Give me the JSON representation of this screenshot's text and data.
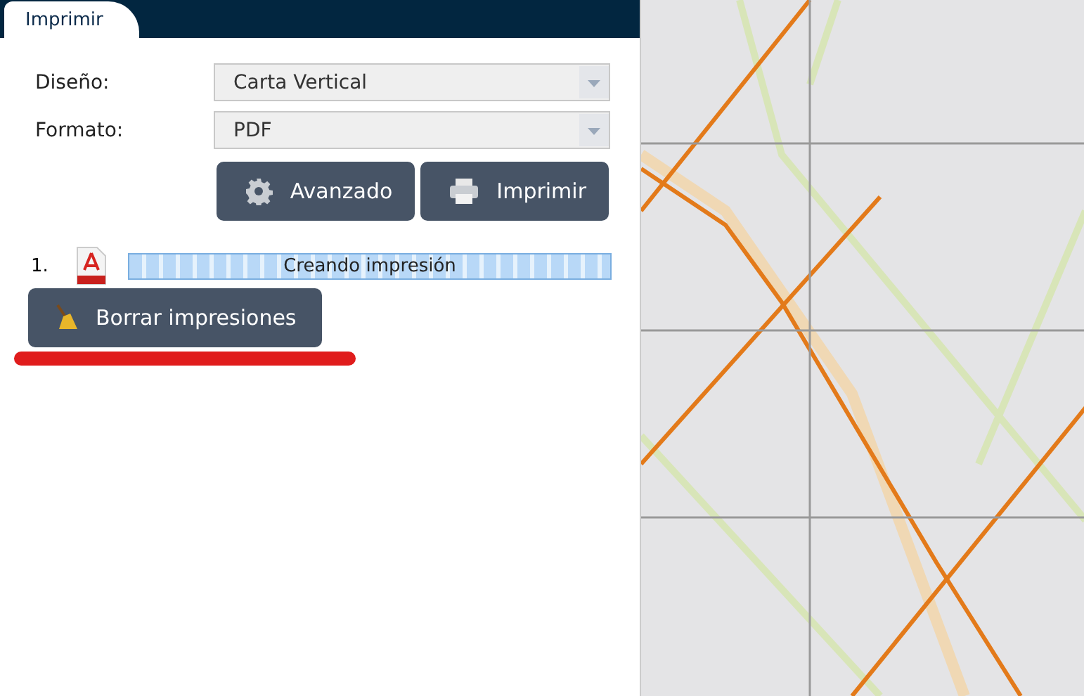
{
  "tabs": [
    {
      "label": "Imprimir",
      "selected": true
    }
  ],
  "fields": [
    {
      "label": "Diseño:",
      "value": "Carta Vertical"
    },
    {
      "label": "Formato:",
      "value": "PDF"
    }
  ],
  "actions": [
    {
      "kind": "settings",
      "label": "Avanzado"
    },
    {
      "kind": "print",
      "label": "Imprimir"
    }
  ],
  "prints": [
    {
      "number": "1.",
      "status": "Creando impresión",
      "level": 1
    }
  ],
  "clear_button": {
    "label": "Borrar impresiones",
    "highlighted": true
  }
}
